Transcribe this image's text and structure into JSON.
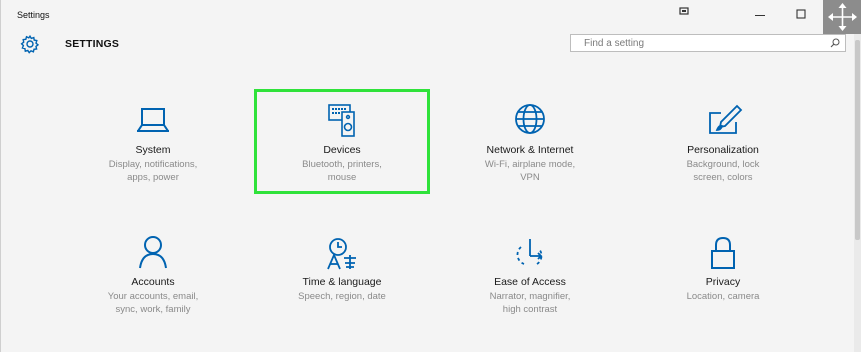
{
  "window": {
    "app_title": "Settings",
    "accent_color": "#0063b1",
    "highlight_color": "#2fe23a"
  },
  "header": {
    "icon": "gear-icon",
    "title": "SETTINGS"
  },
  "search": {
    "placeholder": "Find a setting",
    "icon": "search-icon"
  },
  "categories": [
    {
      "name": "System",
      "description": "Display, notifications,\napps, power",
      "icon": "laptop-icon"
    },
    {
      "name": "Devices",
      "description": "Bluetooth, printers,\nmouse",
      "icon": "devices-icon",
      "highlighted": true
    },
    {
      "name": "Network & Internet",
      "description": "Wi-Fi, airplane mode,\nVPN",
      "icon": "globe-icon"
    },
    {
      "name": "Personalization",
      "description": "Background, lock\nscreen, colors",
      "icon": "paint-icon"
    },
    {
      "name": "Accounts",
      "description": "Your accounts, email,\nsync, work, family",
      "icon": "person-icon"
    },
    {
      "name": "Time & language",
      "description": "Speech, region, date",
      "icon": "time-language-icon"
    },
    {
      "name": "Ease of Access",
      "description": "Narrator, magnifier,\nhigh contrast",
      "icon": "ease-of-access-icon"
    },
    {
      "name": "Privacy",
      "description": "Location, camera",
      "icon": "lock-icon"
    }
  ]
}
